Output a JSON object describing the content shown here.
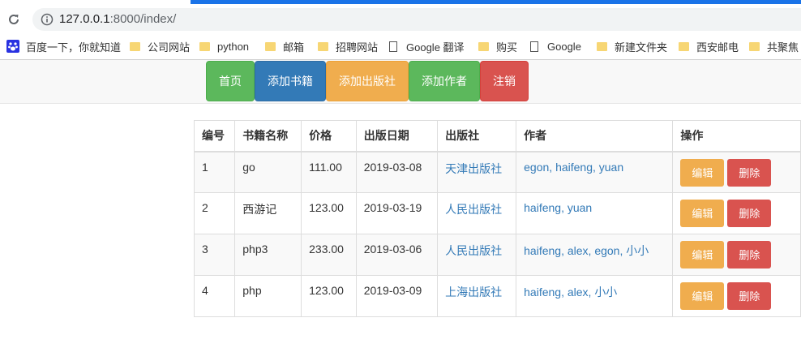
{
  "browser": {
    "url_host": "127.0.0.1",
    "url_rest": ":8000/index/",
    "bookmarks": [
      {
        "label": "百度一下，你就知道",
        "icon": "baidu-paw-icon"
      },
      {
        "label": "公司网站",
        "icon": "folder-icon"
      },
      {
        "label": "python",
        "icon": "folder-icon"
      },
      {
        "label": "邮箱",
        "icon": "folder-icon"
      },
      {
        "label": "招聘网站",
        "icon": "folder-icon"
      },
      {
        "label": "Google 翻译",
        "icon": "page-icon"
      },
      {
        "label": "购买",
        "icon": "folder-icon"
      },
      {
        "label": "Google",
        "icon": "page-icon"
      },
      {
        "label": "新建文件夹",
        "icon": "folder-icon"
      },
      {
        "label": "西安邮电",
        "icon": "folder-icon"
      },
      {
        "label": "共聚焦",
        "icon": "folder-icon"
      }
    ]
  },
  "nav": {
    "home": "首页",
    "add_book": "添加书籍",
    "add_publisher": "添加出版社",
    "add_author": "添加作者",
    "logout": "注销"
  },
  "colors": {
    "success": "#5cb85c",
    "primary": "#337ab7",
    "warning": "#f0ad4e",
    "danger": "#d9534f",
    "link": "#337ab7"
  },
  "table": {
    "headers": [
      "编号",
      "书籍名称",
      "价格",
      "出版日期",
      "出版社",
      "作者",
      "操作"
    ],
    "edit_label": "编辑",
    "delete_label": "删除",
    "rows": [
      {
        "id": "1",
        "name": "go",
        "price": "111.00",
        "date": "2019-03-08",
        "publisher": "天津出版社",
        "authors": "egon, haifeng, yuan"
      },
      {
        "id": "2",
        "name": "西游记",
        "price": "123.00",
        "date": "2019-03-19",
        "publisher": "人民出版社",
        "authors": "haifeng, yuan"
      },
      {
        "id": "3",
        "name": "php3",
        "price": "233.00",
        "date": "2019-03-06",
        "publisher": "人民出版社",
        "authors": "haifeng, alex, egon, 小小"
      },
      {
        "id": "4",
        "name": "php",
        "price": "123.00",
        "date": "2019-03-09",
        "publisher": "上海出版社",
        "authors": "haifeng, alex, 小小"
      }
    ]
  }
}
